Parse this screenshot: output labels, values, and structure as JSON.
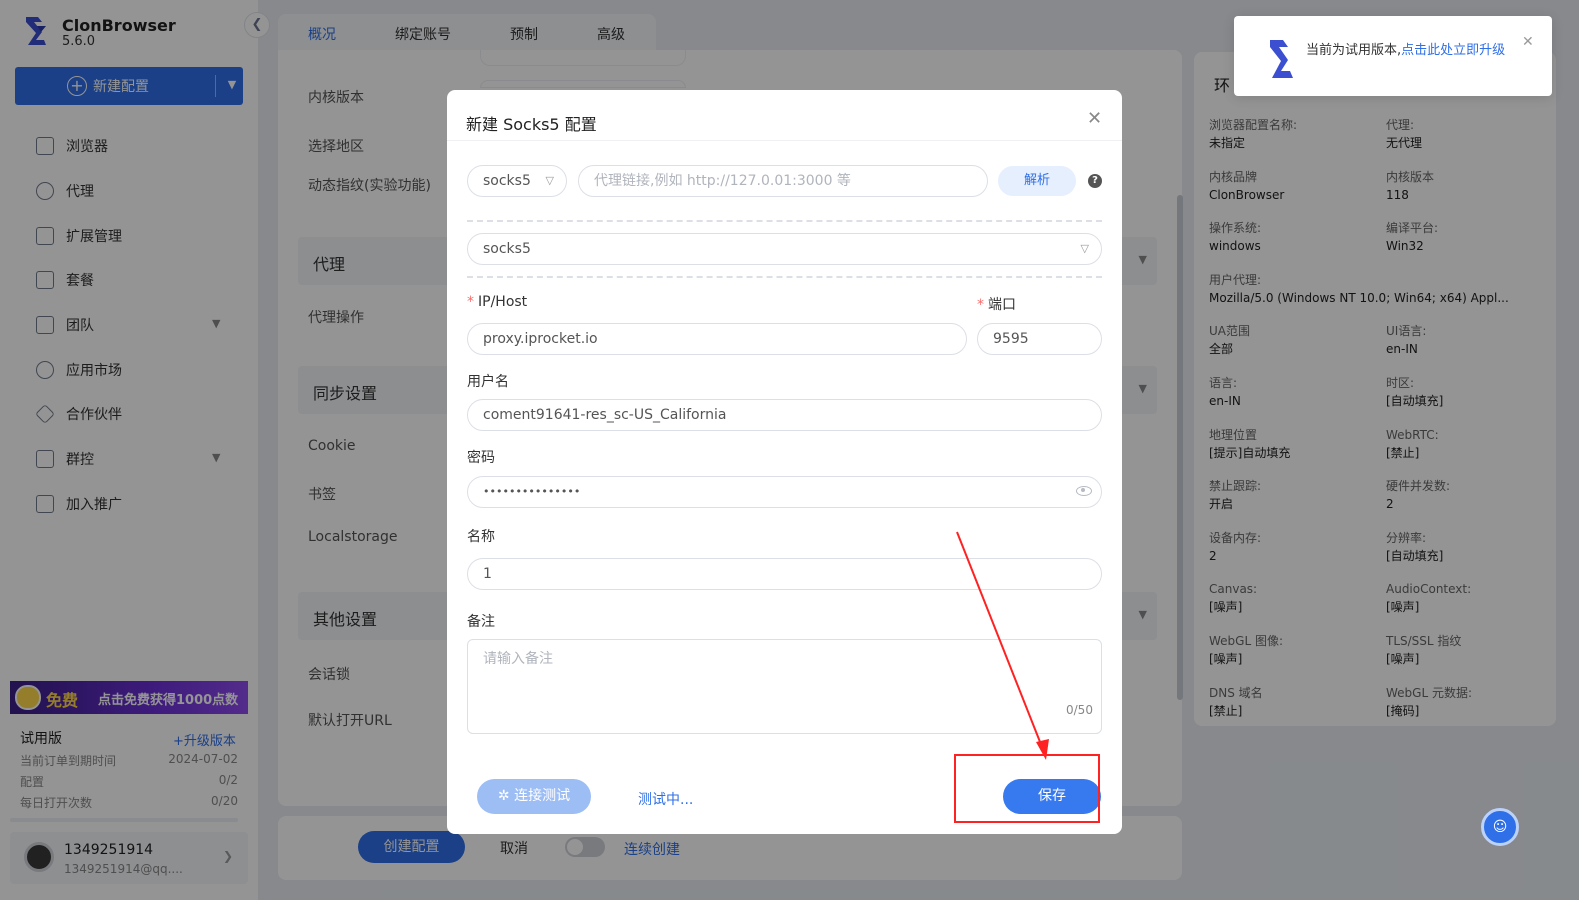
{
  "app": {
    "name": "ClonBrowser",
    "version": "5.6.0"
  },
  "sidebar": {
    "new_config_label": "新建配置",
    "items": [
      {
        "label": "浏览器",
        "icon": "browser-icon"
      },
      {
        "label": "代理",
        "icon": "globe-icon"
      },
      {
        "label": "扩展管理",
        "icon": "puzzle-icon"
      },
      {
        "label": "套餐",
        "icon": "package-icon"
      },
      {
        "label": "团队",
        "icon": "team-icon",
        "expandable": true
      },
      {
        "label": "应用市场",
        "icon": "market-icon"
      },
      {
        "label": "合作伙伴",
        "icon": "handshake-icon"
      },
      {
        "label": "群控",
        "icon": "group-control-icon",
        "expandable": true
      },
      {
        "label": "加入推广",
        "icon": "promotion-icon"
      }
    ],
    "promo": {
      "badge": "免费",
      "text": "点击免费获得1000点数"
    },
    "plan": {
      "title": "试用版",
      "upgrade": "+升级版本",
      "stats": [
        {
          "label": "当前订单到期时间",
          "value": "2024-07-02"
        },
        {
          "label": "配置",
          "value": "0/2"
        },
        {
          "label": "每日打开次数",
          "value": "0/20"
        }
      ]
    },
    "user": {
      "name": "1349251914",
      "email": "1349251914@qq...."
    }
  },
  "tabs": [
    "概况",
    "绑定账号",
    "预制",
    "高级"
  ],
  "form_labels": {
    "kernel_version": "内核版本",
    "region": "选择地区",
    "dynamic_fp": "动态指纹(实验功能)",
    "proxy_section": "代理",
    "proxy_op": "代理操作",
    "sync_section": "同步设置",
    "cookie": "Cookie",
    "bookmark": "书签",
    "localstorage": "Localstorage",
    "other_section": "其他设置",
    "session_lock": "会话锁",
    "default_url": "默认打开URL"
  },
  "bottom_bar": {
    "create": "创建配置",
    "cancel": "取消",
    "continuous": "连续创建"
  },
  "info": {
    "title": "环",
    "items": [
      {
        "k": "浏览器配置名称:",
        "v": "未指定"
      },
      {
        "k": "代理:",
        "v": "无代理"
      },
      {
        "k": "内核品牌",
        "v": "ClonBrowser"
      },
      {
        "k": "内核版本",
        "v": "118"
      },
      {
        "k": "操作系统:",
        "v": "windows"
      },
      {
        "k": "编译平台:",
        "v": "Win32"
      },
      {
        "k": "用户代理:",
        "v": "Mozilla/5.0 (Windows NT 10.0; Win64; x64) Appl..."
      },
      {
        "k": "UA范围",
        "v": "全部"
      },
      {
        "k": "UI语言:",
        "v": "en-IN"
      },
      {
        "k": "语言:",
        "v": "en-IN"
      },
      {
        "k": "时区:",
        "v": "[自动填充]"
      },
      {
        "k": "地理位置",
        "v": "[提示]自动填充"
      },
      {
        "k": "WebRTC:",
        "v": "[禁止]"
      },
      {
        "k": "禁止跟踪:",
        "v": "开启"
      },
      {
        "k": "硬件并发数:",
        "v": "2"
      },
      {
        "k": "设备内存:",
        "v": "2"
      },
      {
        "k": "分辨率:",
        "v": "[自动填充]"
      },
      {
        "k": "Canvas:",
        "v": "[噪声]"
      },
      {
        "k": "AudioContext:",
        "v": "[噪声]"
      },
      {
        "k": "WebGL 图像:",
        "v": "[噪声]"
      },
      {
        "k": "TLS/SSL 指纹",
        "v": "[噪声]"
      },
      {
        "k": "DNS 域名",
        "v": "[禁止]"
      },
      {
        "k": "WebGL 元数据:",
        "v": "[掩码]"
      }
    ]
  },
  "notification": {
    "text": "当前为试用版本,",
    "link": "点击此处立即升级"
  },
  "modal": {
    "title": "新建 Socks5 配置",
    "protocol_select": "socks5",
    "link_placeholder": "代理链接,例如 http://127.0.01:3000 等",
    "parse_label": "解析",
    "type_select": "socks5",
    "host_label": "IP/Host",
    "host_value": "proxy.iprocket.io",
    "port_label": "端口",
    "port_value": "9595",
    "username_label": "用户名",
    "username_value": "coment91641-res_sc-US_California",
    "password_label": "密码",
    "password_value": "•••••••••••••••",
    "name_label": "名称",
    "name_value": "1",
    "note_label": "备注",
    "note_placeholder": "请输入备注",
    "note_counter": "0/50",
    "test_label": "连接测试",
    "testing_label": "测试中...",
    "save_label": "保存"
  },
  "colors": {
    "accent": "#2f6fe8",
    "annotation": "#ff2222"
  }
}
